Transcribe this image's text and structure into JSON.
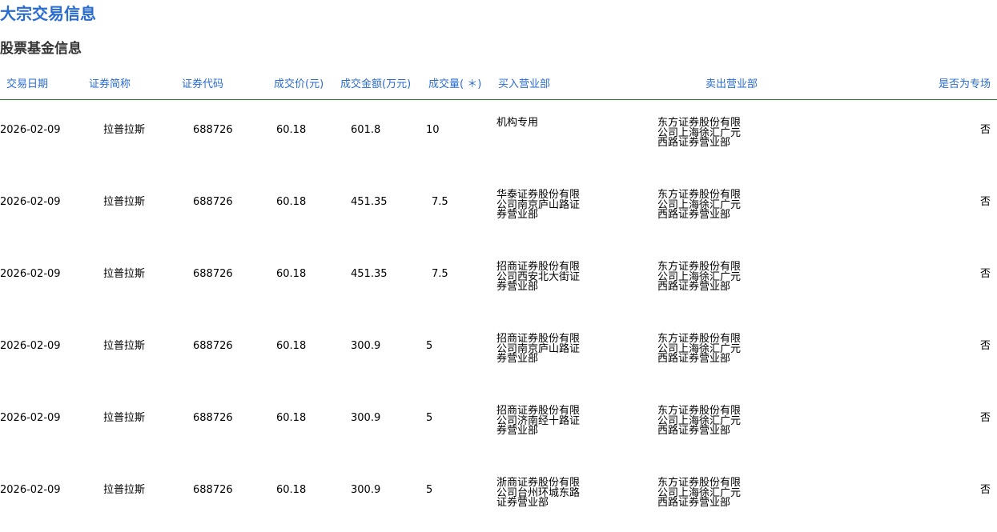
{
  "page_title": "大宗交易信息",
  "section_title": "股票基金信息",
  "columns": [
    "交易日期",
    "证券简称",
    "证券代码",
    "成交价(元)",
    "成交金额(万元)",
    "成交量( ＊)",
    "买入营业部",
    "卖出营业部",
    "是否为专场"
  ],
  "rows": [
    {
      "date": "2026-02-09",
      "name": "拉普拉斯",
      "code": "688726",
      "price": "60.18",
      "amount": "601.8",
      "volume": "10",
      "buyer": [
        "机构专用"
      ],
      "seller": [
        "东方证券股份有限",
        "公司上海徐汇广元",
        "西路证券营业部"
      ],
      "special": "否"
    },
    {
      "date": "2026-02-09",
      "name": "拉普拉斯",
      "code": "688726",
      "price": "60.18",
      "amount": "451.35",
      "volume": "7.5",
      "buyer": [
        "华泰证券股份有限",
        "公司南京庐山路证",
        "券营业部"
      ],
      "seller": [
        "东方证券股份有限",
        "公司上海徐汇广元",
        "西路证券营业部"
      ],
      "special": "否"
    },
    {
      "date": "2026-02-09",
      "name": "拉普拉斯",
      "code": "688726",
      "price": "60.18",
      "amount": "451.35",
      "volume": "7.5",
      "buyer": [
        "招商证券股份有限",
        "公司西安北大街证",
        "券营业部"
      ],
      "seller": [
        "东方证券股份有限",
        "公司上海徐汇广元",
        "西路证券营业部"
      ],
      "special": "否"
    },
    {
      "date": "2026-02-09",
      "name": "拉普拉斯",
      "code": "688726",
      "price": "60.18",
      "amount": "300.9",
      "volume": "5",
      "buyer": [
        "招商证券股份有限",
        "公司南京庐山路证",
        "券营业部"
      ],
      "seller": [
        "东方证券股份有限",
        "公司上海徐汇广元",
        "西路证券营业部"
      ],
      "special": "否"
    },
    {
      "date": "2026-02-09",
      "name": "拉普拉斯",
      "code": "688726",
      "price": "60.18",
      "amount": "300.9",
      "volume": "5",
      "buyer": [
        "招商证券股份有限",
        "公司济南经十路证",
        "券营业部"
      ],
      "seller": [
        "东方证券股份有限",
        "公司上海徐汇广元",
        "西路证券营业部"
      ],
      "special": "否"
    },
    {
      "date": "2026-02-09",
      "name": "拉普拉斯",
      "code": "688726",
      "price": "60.18",
      "amount": "300.9",
      "volume": "5",
      "buyer": [
        "浙商证券股份有限",
        "公司台州环城东路",
        "证券营业部"
      ],
      "seller": [
        "东方证券股份有限",
        "公司上海徐汇广元",
        "西路证券营业部"
      ],
      "special": "否"
    }
  ],
  "colors": {
    "title": "#2a6bd0",
    "header_text": "#2a6bd0",
    "header_rule": "#2e7d32"
  }
}
